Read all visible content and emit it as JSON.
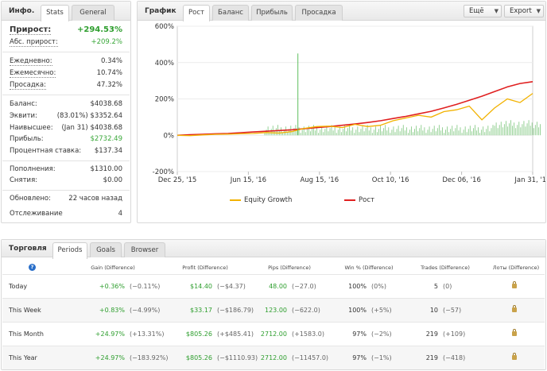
{
  "info": {
    "title": "Инфо.",
    "tabs": [
      "Stats",
      "General"
    ],
    "gain_label": "Прирост:",
    "gain_value": "+294.53%",
    "abs_label": "Абс. прирост:",
    "abs_value": "+209.2%",
    "daily_label": "Ежедневно:",
    "daily_value": "0.34%",
    "monthly_label": "Ежемесячно:",
    "monthly_value": "10.74%",
    "drawdown_label": "Просадка:",
    "drawdown_value": "47.32%",
    "balance_label": "Баланс:",
    "balance_value": "$4038.68",
    "equity_label": "Эквити:",
    "equity_value": "(83.01%) $3352.64",
    "highest_label": "Наивысшее:",
    "highest_value": "(Jan 31) $4038.68",
    "profit_label": "Прибыль:",
    "profit_value": "$2732.49",
    "interest_label": "Процентная ставка:",
    "interest_value": "$137.34",
    "deposits_label": "Пополнения:",
    "deposits_value": "$1310.00",
    "withdrawals_label": "Снятия:",
    "withdrawals_value": "$0.00",
    "updated_label": "Обновлено:",
    "updated_value": "22 часов назад",
    "tracking_label": "Отслеживание",
    "tracking_value": "4"
  },
  "chart_panel": {
    "title": "График",
    "tabs": [
      "Рост",
      "Баланс",
      "Прибыль",
      "Просадка"
    ],
    "more_label": "Ещё",
    "export_label": "Export"
  },
  "chart_data": {
    "type": "line",
    "x_ticks": [
      "Dec 25, '15",
      "Jun 15, '16",
      "Aug 15, '16",
      "Oct 10, '16",
      "Dec 06, '16",
      "Jan 31, '17"
    ],
    "y_ticks": [
      "600%",
      "400%",
      "200%",
      "0%",
      "-200%"
    ],
    "ylim": [
      -200,
      600
    ],
    "series": [
      {
        "name": "Рост",
        "color": "#e02020",
        "values": [
          0,
          3,
          5,
          8,
          10,
          14,
          18,
          22,
          26,
          30,
          36,
          42,
          48,
          55,
          62,
          70,
          80,
          92,
          104,
          118,
          132,
          150,
          170,
          192,
          215,
          240,
          266,
          285,
          295
        ]
      },
      {
        "name": "Equity Growth",
        "color": "#f2b200",
        "values": [
          0,
          -2,
          2,
          5,
          6,
          8,
          10,
          15,
          12,
          20,
          38,
          48,
          50,
          42,
          60,
          48,
          55,
          80,
          95,
          110,
          100,
          130,
          140,
          160,
          85,
          150,
          200,
          180,
          230
        ]
      }
    ],
    "spike": {
      "x_index": 9,
      "value": 450
    }
  },
  "legend": [
    {
      "label": "Equity Growth",
      "color": "#f2b200"
    },
    {
      "label": "Рост",
      "color": "#e02020"
    }
  ],
  "trade": {
    "title": "Торговля",
    "tabs": [
      "Periods",
      "Goals",
      "Browser"
    ],
    "columns": [
      "Gain (Difference)",
      "Profit (Difference)",
      "Pips (Difference)",
      "Win % (Difference)",
      "Trades (Difference)",
      "Лоты (Difference)"
    ],
    "rows": [
      {
        "period": "Today",
        "gain": "+0.36%",
        "gain_diff": "(−0.11%)",
        "profit": "$14.40",
        "profit_diff": "(−$4.37)",
        "pips": "48.00",
        "pips_diff": "(−27.0)",
        "win": "100%",
        "win_diff": "(0%)",
        "trades": "5",
        "trades_diff": "(0)"
      },
      {
        "period": "This Week",
        "gain": "+0.83%",
        "gain_diff": "(−4.99%)",
        "profit": "$33.17",
        "profit_diff": "(−$186.79)",
        "pips": "123.00",
        "pips_diff": "(−622.0)",
        "win": "100%",
        "win_diff": "(+5%)",
        "trades": "10",
        "trades_diff": "(−57)"
      },
      {
        "period": "This Month",
        "gain": "+24.97%",
        "gain_diff": "(+13.31%)",
        "profit": "$805.26",
        "profit_diff": "(+$485.41)",
        "pips": "2712.00",
        "pips_diff": "(+1583.0)",
        "win": "97%",
        "win_diff": "(−2%)",
        "trades": "219",
        "trades_diff": "(+109)"
      },
      {
        "period": "This Year",
        "gain": "+24.97%",
        "gain_diff": "(−183.92%)",
        "profit": "$805.26",
        "profit_diff": "(−$1110.93)",
        "pips": "2712.00",
        "pips_diff": "(−11457.0)",
        "win": "97%",
        "win_diff": "(−1%)",
        "trades": "219",
        "trades_diff": "(−418)"
      }
    ]
  }
}
